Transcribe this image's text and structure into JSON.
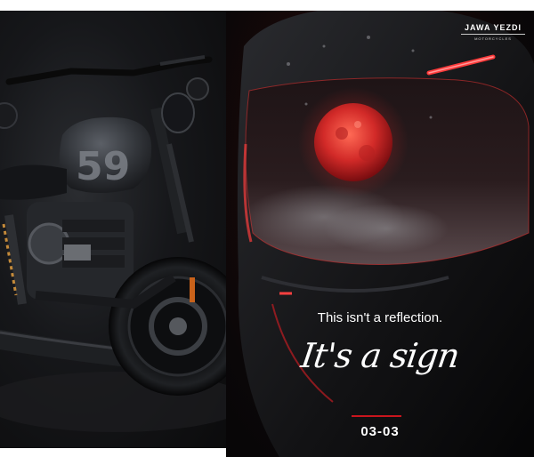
{
  "brand": {
    "name": "JAWA YEZDI",
    "sub": "MOTORCYCLES"
  },
  "poster": {
    "tagline": "This isn't a reflection.",
    "script_line": "It's a sign",
    "date": "03-03"
  },
  "colors": {
    "accent_red": "#c9151d",
    "moon_red": "#d22a28",
    "background_dark": "#0b0b0c"
  },
  "icons": {
    "motorcycle": "motorcycle-image",
    "helmet": "helmet-image",
    "moon": "moon-reflection"
  }
}
